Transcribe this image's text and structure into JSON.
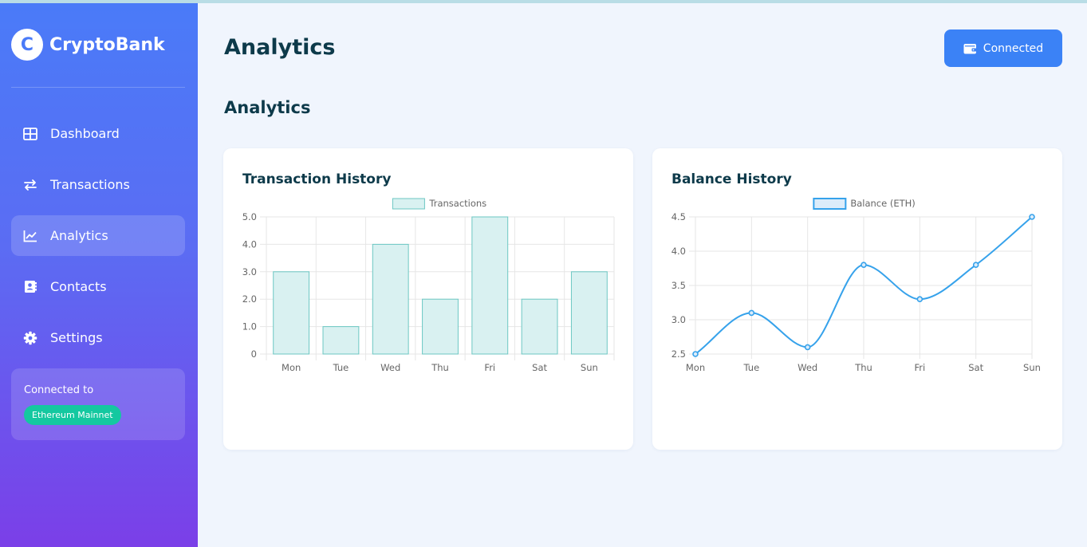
{
  "app": {
    "logo_letter": "C",
    "name": "CryptoBank"
  },
  "sidebar": {
    "items": [
      {
        "label": "Dashboard",
        "icon": "dashboard-grid-icon",
        "active": false
      },
      {
        "label": "Transactions",
        "icon": "swap-arrows-icon",
        "active": false
      },
      {
        "label": "Analytics",
        "icon": "line-chart-icon",
        "active": true
      },
      {
        "label": "Contacts",
        "icon": "contact-book-icon",
        "active": false
      },
      {
        "label": "Settings",
        "icon": "gear-icon",
        "active": false
      }
    ],
    "network": {
      "label": "Connected to",
      "badge": "Ethereum Mainnet"
    }
  },
  "header": {
    "title": "Analytics",
    "connect_button": "Connected",
    "connect_icon": "wallet-icon"
  },
  "section": {
    "title": "Analytics"
  },
  "colors": {
    "accent": "#3b82f6",
    "badge": "#14c8a0",
    "bar_fill": "#d9f1f1",
    "bar_stroke": "#6cc7c3",
    "line": "#36a2eb",
    "line_fill": "#dcecfa"
  },
  "chart_data": [
    {
      "type": "bar",
      "title": "Transaction History",
      "categories": [
        "Mon",
        "Tue",
        "Wed",
        "Thu",
        "Fri",
        "Sat",
        "Sun"
      ],
      "series": [
        {
          "name": "Transactions",
          "values": [
            3,
            1,
            4,
            2,
            5,
            2,
            3
          ]
        }
      ],
      "ylim": [
        0,
        5
      ],
      "yticks": [
        0,
        1,
        2,
        3,
        4,
        5
      ],
      "ytick_labels": [
        "0",
        "1.0",
        "2.0",
        "3.0",
        "4.0",
        "5.0"
      ],
      "grid": true,
      "legend": "top-center"
    },
    {
      "type": "line",
      "title": "Balance History",
      "categories": [
        "Mon",
        "Tue",
        "Wed",
        "Thu",
        "Fri",
        "Sat",
        "Sun"
      ],
      "series": [
        {
          "name": "Balance (ETH)",
          "values": [
            2.5,
            3.1,
            2.6,
            3.8,
            3.3,
            3.8,
            4.5
          ]
        }
      ],
      "ylim": [
        2.5,
        4.5
      ],
      "yticks": [
        2.5,
        3.0,
        3.5,
        4.0,
        4.5
      ],
      "ytick_labels": [
        "2.5",
        "3.0",
        "3.5",
        "4.0",
        "4.5"
      ],
      "grid": true,
      "legend": "top-center"
    }
  ]
}
